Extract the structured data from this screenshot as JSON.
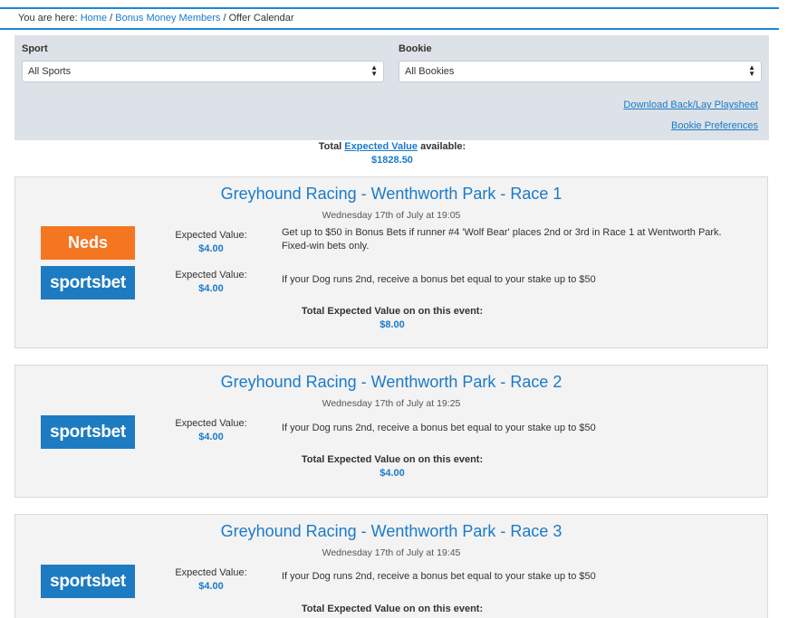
{
  "breadcrumb": {
    "prefix": "You are here:",
    "home": "Home",
    "sep1": " / ",
    "members": "Bonus Money Members",
    "sep2": " / ",
    "current": "Offer Calendar"
  },
  "filters": {
    "sport_label": "Sport",
    "sport_value": "All Sports",
    "bookie_label": "Bookie",
    "bookie_value": "All Bookies",
    "download_link": "Download Back/Lay Playsheet",
    "preferences_link": "Bookie Preferences"
  },
  "total": {
    "prefix": "Total ",
    "ev_link": "Expected Value",
    "suffix": " available:",
    "amount": "$1828.50"
  },
  "events": [
    {
      "title": "Greyhound Racing - Wenthworth Park - Race 1",
      "date": "Wednesday 17th of July at 19:05",
      "offers": [
        {
          "bookie": "Neds",
          "ev_label": "Expected Value:",
          "ev": "$4.00",
          "desc": "Get up to $50 in Bonus Bets if runner #4 'Wolf Bear' places 2nd or 3rd in Race 1 at Wentworth Park. Fixed-win bets only."
        },
        {
          "bookie": "sportsbet",
          "ev_label": "Expected Value:",
          "ev": "$4.00",
          "desc": "If your Dog runs 2nd, receive a bonus bet equal to your stake up to $50"
        }
      ],
      "total_label": "Total Expected Value on on this event:",
      "total": "$8.00"
    },
    {
      "title": "Greyhound Racing - Wenthworth Park - Race 2",
      "date": "Wednesday 17th of July at 19:25",
      "offers": [
        {
          "bookie": "sportsbet",
          "ev_label": "Expected Value:",
          "ev": "$4.00",
          "desc": "If your Dog runs 2nd, receive a bonus bet equal to your stake up to $50"
        }
      ],
      "total_label": "Total Expected Value on on this event:",
      "total": "$4.00"
    },
    {
      "title": "Greyhound Racing - Wenthworth Park - Race 3",
      "date": "Wednesday 17th of July at 19:45",
      "offers": [
        {
          "bookie": "sportsbet",
          "ev_label": "Expected Value:",
          "ev": "$4.00",
          "desc": "If your Dog runs 2nd, receive a bonus bet equal to your stake up to $50"
        }
      ],
      "total_label": "Total Expected Value on on this event:",
      "total": ""
    }
  ],
  "colors": {
    "accent": "#1a7ac8",
    "neds": "#f47621",
    "sportsbet": "#1d7bc1"
  }
}
